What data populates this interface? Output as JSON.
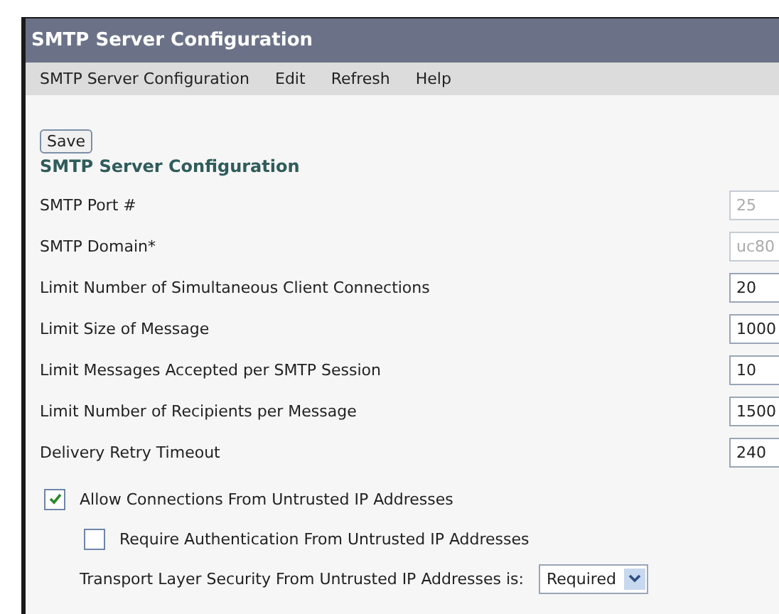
{
  "window": {
    "title": "SMTP Server Configuration"
  },
  "menu": [
    {
      "label": "SMTP Server Configuration"
    },
    {
      "label": "Edit"
    },
    {
      "label": "Refresh"
    },
    {
      "label": "Help"
    }
  ],
  "toolbar": {
    "save_button": "Save"
  },
  "section_title": "SMTP Server Configuration",
  "fields": [
    {
      "label": "SMTP Port #",
      "value": "25",
      "disabled": true
    },
    {
      "label": "SMTP Domain*",
      "value": "uc80",
      "disabled": true
    },
    {
      "label": "Limit Number of Simultaneous Client Connections",
      "value": "20",
      "disabled": false
    },
    {
      "label": "Limit Size of Message",
      "value": "1000",
      "disabled": false
    },
    {
      "label": "Limit Messages Accepted per SMTP Session",
      "value": "10",
      "disabled": false
    },
    {
      "label": "Limit Number of Recipients per Message",
      "value": "1500",
      "disabled": false
    },
    {
      "label": "Delivery Retry Timeout",
      "value": "240",
      "disabled": false
    }
  ],
  "options": [
    {
      "kind": "checkbox",
      "label": "Allow Connections From Untrusted IP Addresses",
      "checked": true,
      "children": [
        {
          "kind": "checkbox",
          "label": "Require Authentication From Untrusted IP Addresses",
          "checked": false
        },
        {
          "kind": "select",
          "label": "Transport Layer Security From Untrusted IP Addresses is:",
          "value": "Required"
        }
      ]
    }
  ]
}
